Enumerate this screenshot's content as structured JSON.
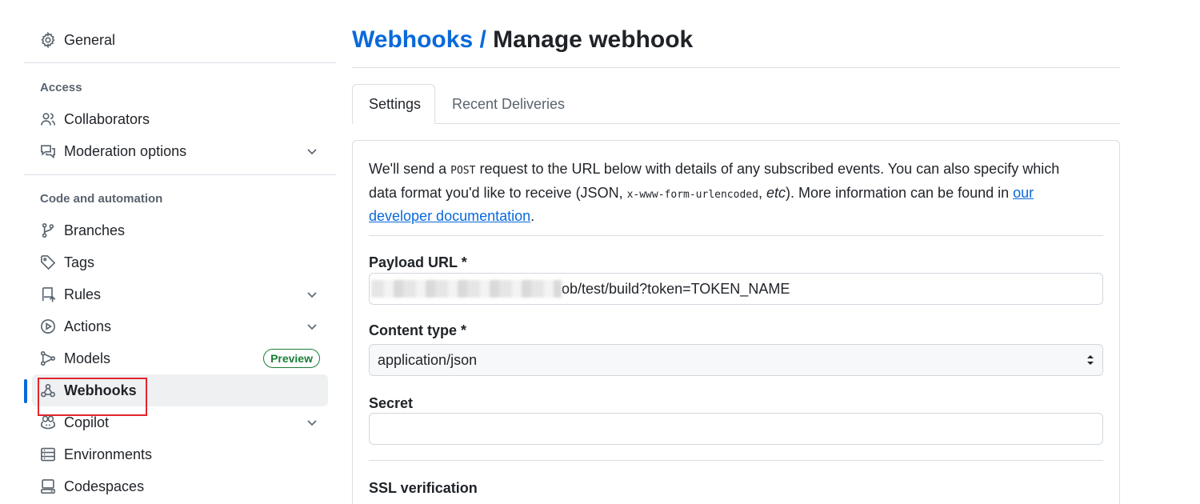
{
  "sidebar": {
    "general": "General",
    "access_heading": "Access",
    "collaborators": "Collaborators",
    "moderation": "Moderation options",
    "code_heading": "Code and automation",
    "branches": "Branches",
    "tags": "Tags",
    "rules": "Rules",
    "actions": "Actions",
    "models": "Models",
    "models_badge": "Preview",
    "webhooks": "Webhooks",
    "copilot": "Copilot",
    "environments": "Environments",
    "codespaces": "Codespaces",
    "colors": {
      "active_indicator": "#0969da",
      "highlight": "#e5242b",
      "badge": "#1a7f37"
    }
  },
  "header": {
    "breadcrumb": "Webhooks",
    "separator": "/",
    "title": "Manage webhook"
  },
  "tabs": {
    "settings": "Settings",
    "deliveries": "Recent Deliveries"
  },
  "form": {
    "intro_part1": "We'll send a ",
    "intro_code1": "POST",
    "intro_part2": " request to the URL below with details of any subscribed events. You can also specify which data format you'd like to receive (JSON, ",
    "intro_code2": "x-www-form-urlencoded",
    "intro_part3": ", ",
    "intro_em": "etc",
    "intro_part4": "). More information can be found in ",
    "intro_link": "our developer documentation",
    "intro_end": ".",
    "payload_label": "Payload URL *",
    "payload_value_visible": "ob/test/build?token=TOKEN_NAME",
    "content_type_label": "Content type *",
    "content_type_value": "application/json",
    "secret_label": "Secret",
    "secret_value": "",
    "ssl_label": "SSL verification"
  }
}
